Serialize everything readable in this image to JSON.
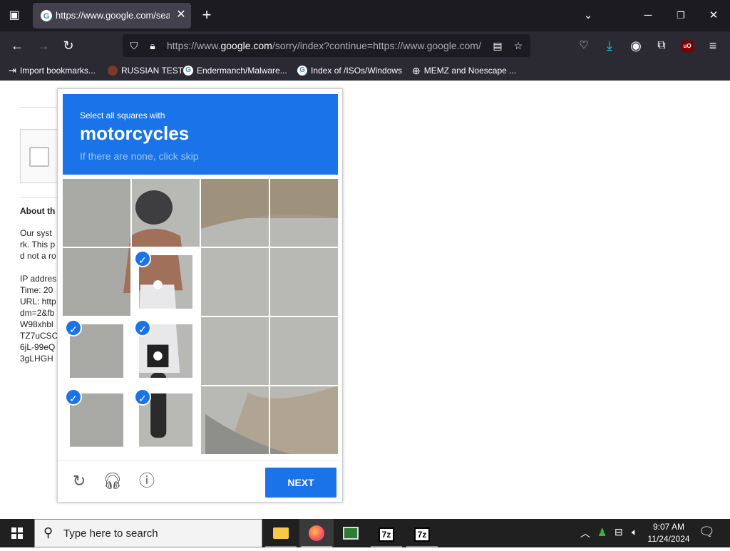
{
  "browser": {
    "tab_title": "https://www.google.com/searc",
    "url_prefix": "https://www.",
    "url_domain": "google.com",
    "url_rest": "/sorry/index?continue=https://www.google.com/",
    "bookmarks": [
      {
        "label": "Import bookmarks..."
      },
      {
        "label": "RUSSIAN TEST"
      },
      {
        "label": "Endermanch/Malware..."
      },
      {
        "label": "Index of /ISOs/Windows"
      },
      {
        "label": "MEMZ and Noescape ..."
      }
    ],
    "extension_badge": "uO"
  },
  "page": {
    "about_heading": "About th",
    "para_lines": [
      "Our syst",
      "rk. This p",
      "d not a ro"
    ],
    "info_lines": [
      "IP addres",
      "Time: 20",
      "URL: http",
      "dm=2&fb",
      "W98xhbl",
      "TZ7uCSC",
      "6jL-99eQ",
      "3gLHGH"
    ]
  },
  "captcha": {
    "line1": "Select all squares with",
    "object": "motorcycles",
    "line3": "If there are none, click skip",
    "next_label": "NEXT",
    "selected_tiles": [
      5,
      8,
      9,
      12,
      13
    ]
  },
  "taskbar": {
    "search_placeholder": "Type here to search",
    "time": "9:07 AM",
    "date": "11/24/2024",
    "app_7z_label": "7z"
  },
  "colors": {
    "captcha_blue": "#1a73e8",
    "tabbar": "#1c1b22",
    "toolbar": "#2b2a33"
  }
}
